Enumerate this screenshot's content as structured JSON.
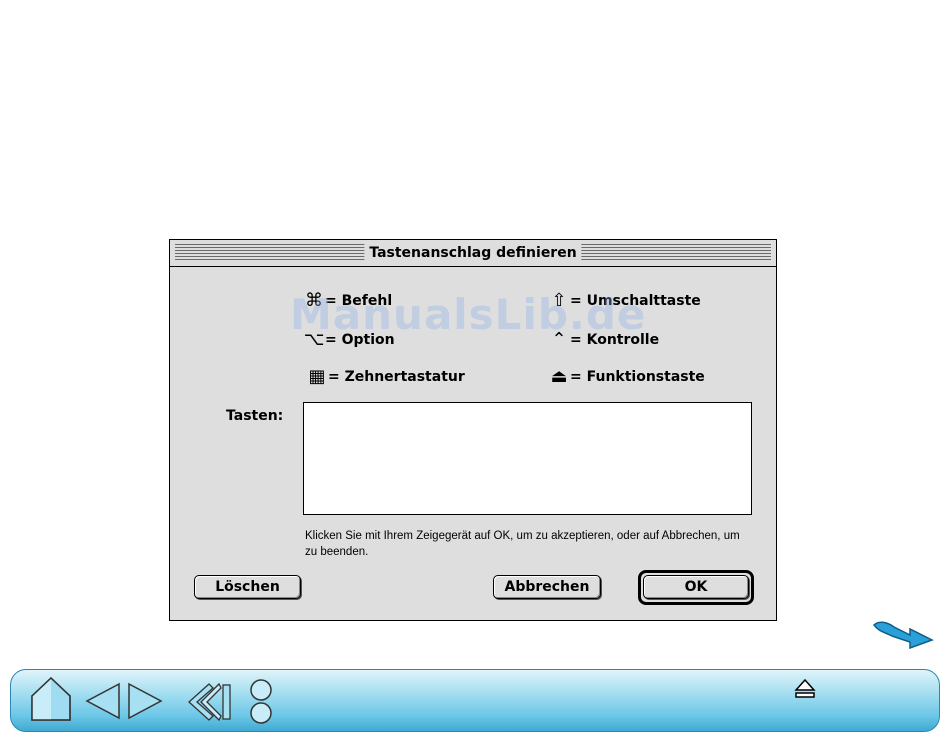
{
  "dialog": {
    "title": "Tastenanschlag definieren",
    "legend": [
      {
        "icon": "command-key-icon",
        "glyph": "⌘",
        "label": "= Befehl"
      },
      {
        "icon": "shift-key-icon",
        "glyph": "⇧",
        "label": "= Umschalttaste"
      },
      {
        "icon": "option-key-icon",
        "glyph": "⌥",
        "label": "= Option"
      },
      {
        "icon": "control-key-icon",
        "glyph": "⌃",
        "label": "= Kontrolle"
      },
      {
        "icon": "numeric-keypad-icon",
        "glyph": "▦",
        "label": "= Zehnertastatur"
      },
      {
        "icon": "function-key-icon",
        "glyph": "⏏",
        "label": "= Funktionstaste"
      }
    ],
    "keys_label": "Tasten:",
    "keys_value": "",
    "hint": "Klicken Sie mit Ihrem Zeigegerät auf OK, um zu akzeptieren, oder auf Abbrechen, um zu beenden.",
    "buttons": {
      "clear": "Löschen",
      "cancel": "Abbrechen",
      "ok": "OK"
    }
  },
  "watermark": "ManualsLib.de",
  "colors": {
    "dialog_bg": "#dedede",
    "navbar_top": "#dff4fb",
    "navbar_bottom": "#40a9d2",
    "accent_blue": "#1f8fc7"
  },
  "navbar": {
    "icons": [
      "home-icon",
      "previous-page-icon",
      "next-page-icon",
      "back-icon",
      "stacked-circles-icon",
      "eject-icon"
    ]
  }
}
